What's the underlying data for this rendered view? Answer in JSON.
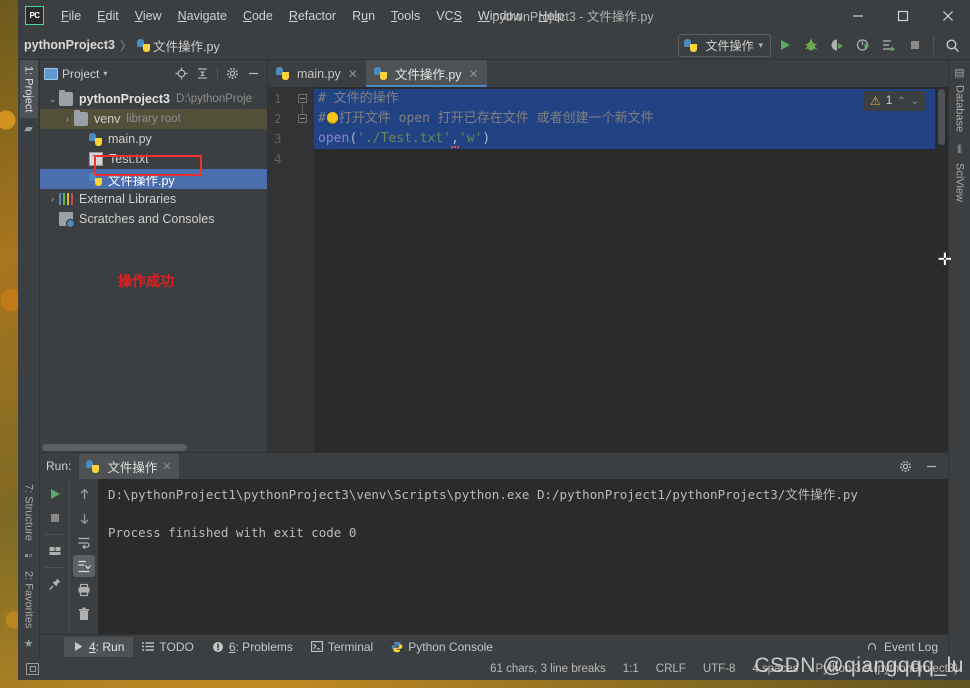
{
  "window": {
    "title": "pythonProject3 - 文件操作.py",
    "logo": "pycharm-logo",
    "minimize": "–",
    "maximize": "□",
    "close": "✕"
  },
  "menubar": {
    "items": [
      {
        "label": "File"
      },
      {
        "label": "Edit"
      },
      {
        "label": "View"
      },
      {
        "label": "Navigate"
      },
      {
        "label": "Code"
      },
      {
        "label": "Refactor"
      },
      {
        "label": "Run"
      },
      {
        "label": "Tools"
      },
      {
        "label": "VCS"
      },
      {
        "label": "Window"
      },
      {
        "label": "Help"
      }
    ]
  },
  "navbar": {
    "project": "pythonProject3",
    "separator": "〉",
    "file": "文件操作.py",
    "run_config": "文件操作",
    "run_config_caret": "▾",
    "buttons": [
      {
        "name": "run-button",
        "glyph": "▶",
        "color": "#59a869"
      },
      {
        "name": "debug-button",
        "glyph": "🐞",
        "color": "#6aa84f"
      },
      {
        "name": "run-coverage-button",
        "glyph": "◖",
        "color": "#b0b0b0"
      },
      {
        "name": "profile-button",
        "glyph": "◷",
        "color": "#b0b0b0"
      },
      {
        "name": "run-with-console-button",
        "glyph": "≡▸",
        "color": "#b0b0b0"
      },
      {
        "name": "stop-button",
        "glyph": "■",
        "color": "#9a9a9a"
      },
      {
        "name": "search-everywhere-button",
        "glyph": "🔍",
        "color": "#c8c8c8"
      }
    ]
  },
  "left_rail": {
    "tabs": [
      {
        "label": "1: Project",
        "underline": "1",
        "active": true,
        "icon": "folder-icon"
      },
      {
        "label": "7: Structure",
        "underline": "7",
        "active": false,
        "icon": "structure-icon"
      },
      {
        "label": "2: Favorites",
        "underline": "2",
        "active": false,
        "icon": "star-icon"
      }
    ]
  },
  "right_rail": {
    "tabs": [
      {
        "label": "Database",
        "icon": "database-icon"
      },
      {
        "label": "SciView",
        "icon": "grid-icon"
      }
    ]
  },
  "project_panel": {
    "title": "Project",
    "caret": "▾",
    "tools": [
      {
        "name": "locate-icon",
        "glyph": "⊕"
      },
      {
        "name": "collapse-all-icon",
        "glyph": "⇲"
      },
      {
        "name": "settings-gear-icon",
        "glyph": "⚙"
      },
      {
        "name": "hide-panel-icon",
        "glyph": "—"
      }
    ],
    "tree": [
      {
        "arrow": "⌄",
        "icon": "folder-icon",
        "label": "pythonProject3",
        "dim": "D:\\pythonProje",
        "bold": true,
        "state": "none",
        "indent": 0
      },
      {
        "arrow": "›",
        "icon": "folder-icon",
        "label": "venv",
        "dim": "library root",
        "bold": false,
        "state": "hl",
        "indent": 1
      },
      {
        "arrow": "",
        "icon": "python-file-icon",
        "label": "main.py",
        "dim": "",
        "bold": false,
        "state": "none",
        "indent": 2
      },
      {
        "arrow": "",
        "icon": "text-file-icon",
        "label": "Test.txt",
        "dim": "",
        "bold": false,
        "state": "boxed",
        "indent": 2
      },
      {
        "arrow": "",
        "icon": "python-file-icon",
        "label": "文件操作.py",
        "dim": "",
        "bold": false,
        "state": "sel",
        "indent": 2
      },
      {
        "arrow": "›",
        "icon": "external-libraries-icon",
        "label": "External Libraries",
        "dim": "",
        "bold": false,
        "state": "none",
        "indent": 0
      },
      {
        "arrow": "",
        "icon": "scratches-icon",
        "label": "Scratches and Consoles",
        "dim": "",
        "bold": false,
        "state": "none",
        "indent": 0
      }
    ],
    "annotation": "操作成功",
    "annotation_color": "#e02020",
    "highlight_color": "#f03030"
  },
  "editor": {
    "tabs": [
      {
        "label": "main.py",
        "icon": "python-file-icon",
        "close": "✕",
        "active": false
      },
      {
        "label": "文件操作.py",
        "icon": "python-file-icon",
        "close": "✕",
        "active": true
      }
    ],
    "line_numbers": [
      "1",
      "2",
      "3",
      "4"
    ],
    "lines": [
      {
        "num": "1",
        "selected": true,
        "tokens": [
          {
            "t": "comment",
            "v": "# 文件的操作"
          }
        ]
      },
      {
        "num": "2",
        "selected": true,
        "tokens": [
          {
            "t": "comment",
            "v": "#"
          },
          {
            "t": "bulb",
            "v": ""
          },
          {
            "t": "comment",
            "v": "打开文件 open 打开已存在文件 或者创建一个新文件"
          }
        ]
      },
      {
        "num": "3",
        "selected": true,
        "tokens": [
          {
            "t": "kw",
            "v": "open"
          },
          {
            "t": "punct",
            "v": "("
          },
          {
            "t": "str",
            "v": "'./Test.txt'"
          },
          {
            "t": "squiggle",
            "v": ","
          },
          {
            "t": "str",
            "v": "'w'"
          },
          {
            "t": "punct",
            "v": ")"
          }
        ]
      },
      {
        "num": "4",
        "selected": false,
        "tokens": []
      }
    ],
    "warning_badge": {
      "icon": "warning-triangle-icon",
      "count": "1",
      "up": "⌃",
      "down": "⌄"
    }
  },
  "run_panel": {
    "label": "Run:",
    "tab": "文件操作",
    "tab_close": "✕",
    "header_buttons": [
      {
        "name": "settings-gear-icon",
        "glyph": "⚙"
      },
      {
        "name": "hide-panel-icon",
        "glyph": "—"
      }
    ],
    "rail_left": [
      {
        "name": "rerun-button",
        "glyph": "▶",
        "color": "#59a869",
        "active": false
      },
      {
        "name": "stop-button",
        "glyph": "■",
        "color": "#8a8a8a",
        "active": false
      },
      {
        "name": "restore-layout-button",
        "glyph": "▤",
        "color": "#b0b0b0",
        "active": false
      },
      {
        "name": "pin-tab-button",
        "glyph": "📌",
        "color": "#b0b0b0",
        "active": false
      }
    ],
    "rail_right": [
      {
        "name": "prev-occurrence-button",
        "glyph": "↑",
        "color": "#9a9a9a",
        "active": false
      },
      {
        "name": "next-occurrence-button",
        "glyph": "↓",
        "color": "#9a9a9a",
        "active": false
      },
      {
        "name": "soft-wrap-button",
        "glyph": "⏎",
        "color": "#b0b0b0",
        "active": false
      },
      {
        "name": "scroll-to-end-button",
        "glyph": "⤓",
        "color": "#d0d0d0",
        "active": true
      },
      {
        "name": "print-button",
        "glyph": "🖨",
        "color": "#b0b0b0",
        "active": false
      },
      {
        "name": "clear-all-button",
        "glyph": "🗑",
        "color": "#b0b0b0",
        "active": false
      }
    ],
    "console_lines": [
      "D:\\pythonProject1\\pythonProject3\\venv\\Scripts\\python.exe D:/pythonProject1/pythonProject3/文件操作.py",
      "",
      "Process finished with exit code 0"
    ]
  },
  "tool_window_bar": {
    "items": [
      {
        "label": "4: Run",
        "underline": "4",
        "icon": "run-icon",
        "active": true
      },
      {
        "label": "TODO",
        "underline": "",
        "icon": "todo-icon",
        "active": false
      },
      {
        "label": "6: Problems",
        "underline": "6",
        "icon": "problems-icon",
        "active": false
      },
      {
        "label": "Terminal",
        "underline": "",
        "icon": "terminal-icon",
        "active": false
      },
      {
        "label": "Python Console",
        "underline": "",
        "icon": "python-console-icon",
        "active": false
      }
    ],
    "event_log": {
      "label": "Event Log",
      "icon": "bell-icon"
    }
  },
  "statusbar": {
    "toggle_icon": "toggle-toolwindows-icon",
    "chars": "61 chars, 3 line breaks",
    "caret": "1:1",
    "line_sep": "CRLF",
    "encoding": "UTF-8",
    "indent": "4 spaces",
    "interpreter": "Python 3.9 (pythonProject3)",
    "watermark": "CSDN @qiangqqq_lu"
  }
}
